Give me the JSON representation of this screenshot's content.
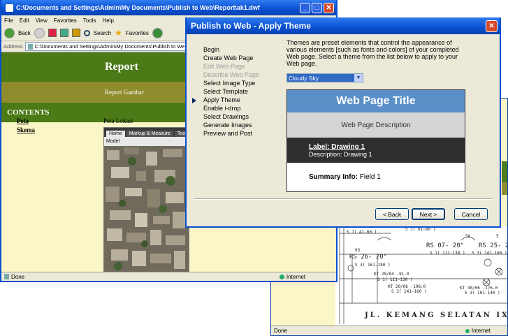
{
  "browser_main": {
    "title": "C:\\Documents and Settings\\Admin\\My Documents\\Publish to Web\\Report\\ak1.dwf",
    "menu": [
      "File",
      "Edit",
      "View",
      "Favorites",
      "Tools",
      "Help"
    ],
    "toolbar": {
      "back": "Back",
      "search": "Search",
      "favorites": "Favorites"
    },
    "address_label": "Address",
    "address_value": "C:\\Documents and Settings\\Admin\\My Documents\\Publish to Web\\Repo",
    "report_title": "Report",
    "report_subtitle": "Report Gambar",
    "contents_heading": "CONTENTS",
    "nav_links": [
      "Peta",
      "Skema"
    ],
    "map_label": "Peta Lokasi",
    "viewer": {
      "tabs": [
        "Home",
        "Markup & Measure",
        "Too"
      ],
      "model_label": "Model"
    },
    "status_left": "Done",
    "status_right": "Internet"
  },
  "browser_back": {
    "status_left": "Done",
    "status_right": "Internet",
    "schematic": {
      "street_label": "JL. KEMANG SELATAN IX",
      "labels": [
        "S 1( 41-60 )",
        "S 1( 61-80 )",
        "5A",
        "5",
        "93",
        "RS 07- 20\"",
        "RS 25- 2",
        "RS 26- 20\"",
        "S 1( 112-138 )",
        "S 3( 141-160 )",
        "S 3( 161-180 )",
        "KT 20/04 -91.0",
        "S 1( 111-130 )",
        "KT 20/06 -108.0",
        "S 3( 141-160 )",
        "KT 40/06 -176.0",
        "S 3( 101-140 )"
      ]
    }
  },
  "dialog": {
    "title": "Publish to Web - Apply Theme",
    "description": "Themes are preset elements that control the appearance of various elements [such as fonts and colors] of your completed Web page.  Select a theme from the list below to apply to your Web page.",
    "steps": [
      {
        "label": "Begin",
        "state": "normal"
      },
      {
        "label": "Create Web Page",
        "state": "normal"
      },
      {
        "label": "Edit Web Page",
        "state": "disabled"
      },
      {
        "label": "Describe Web Page",
        "state": "disabled"
      },
      {
        "label": "Select Image Type",
        "state": "normal"
      },
      {
        "label": "Select Template",
        "state": "normal"
      },
      {
        "label": "Apply Theme",
        "state": "current"
      },
      {
        "label": "Enable i-drop",
        "state": "normal"
      },
      {
        "label": "Select Drawings",
        "state": "normal"
      },
      {
        "label": "Generate Images",
        "state": "normal"
      },
      {
        "label": "Preview and Post",
        "state": "normal"
      }
    ],
    "theme_selected": "Cloudy Sky",
    "preview": {
      "title": "Web Page Title",
      "description": "Web Page Description",
      "label": "Label: Drawing 1",
      "label_description": "Description: Drawing 1",
      "summary_label": "Summary Info:",
      "summary_value": "Field 1"
    },
    "buttons": {
      "back": "< Back",
      "next": "Next >",
      "cancel": "Cancel"
    }
  },
  "colors": {
    "xp_blue": "#0a4fd0",
    "report_green": "#4b7a16",
    "report_olive": "#8f8c2e",
    "theme_title": "#5a8fc8"
  }
}
